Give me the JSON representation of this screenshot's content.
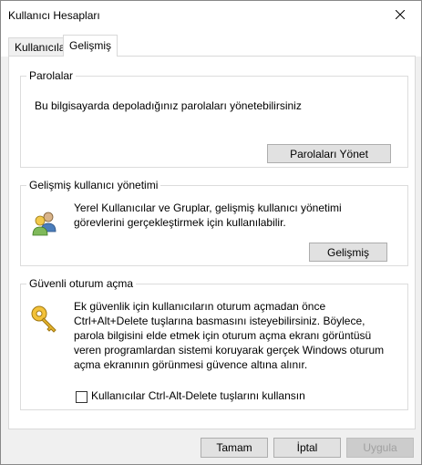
{
  "window": {
    "title": "Kullanıcı Hesapları"
  },
  "tabs": [
    {
      "label": "Kullanıcılar",
      "active": false
    },
    {
      "label": "Gelişmiş",
      "active": true
    }
  ],
  "passwords": {
    "legend": "Parolalar",
    "description": "Bu bilgisayarda depoladığınız parolaları yönetebilirsiniz",
    "button": "Parolaları Yönet"
  },
  "advanced_users": {
    "legend": "Gelişmiş kullanıcı yönetimi",
    "line1": "Yerel Kullanıcılar ve Gruplar, gelişmiş kullanıcı yönetimi",
    "line2": "görevlerini gerçekleştirmek için kullanılabilir.",
    "button": "Gelişmiş"
  },
  "secure_logon": {
    "legend": "Güvenli oturum açma",
    "lines": [
      "Ek güvenlik için kullanıcıların oturum açmadan önce",
      "Ctrl+Alt+Delete tuşlarına basmasını isteyebilirsiniz. Böylece,",
      "parola bilgisini elde etmek için oturum açma ekranı görüntüsü",
      "veren programlardan sistemi koruyarak gerçek Windows oturum",
      "açma ekranının görünmesi güvence altına alınır."
    ],
    "checkbox_label": "Kullanıcılar Ctrl-Alt-Delete tuşlarını kullansın",
    "checkbox_checked": false
  },
  "footer": {
    "ok": "Tamam",
    "cancel": "İptal",
    "apply": "Uygula"
  },
  "icons": {
    "close": "close-icon",
    "users": "users-group-icon",
    "key": "key-icon"
  }
}
